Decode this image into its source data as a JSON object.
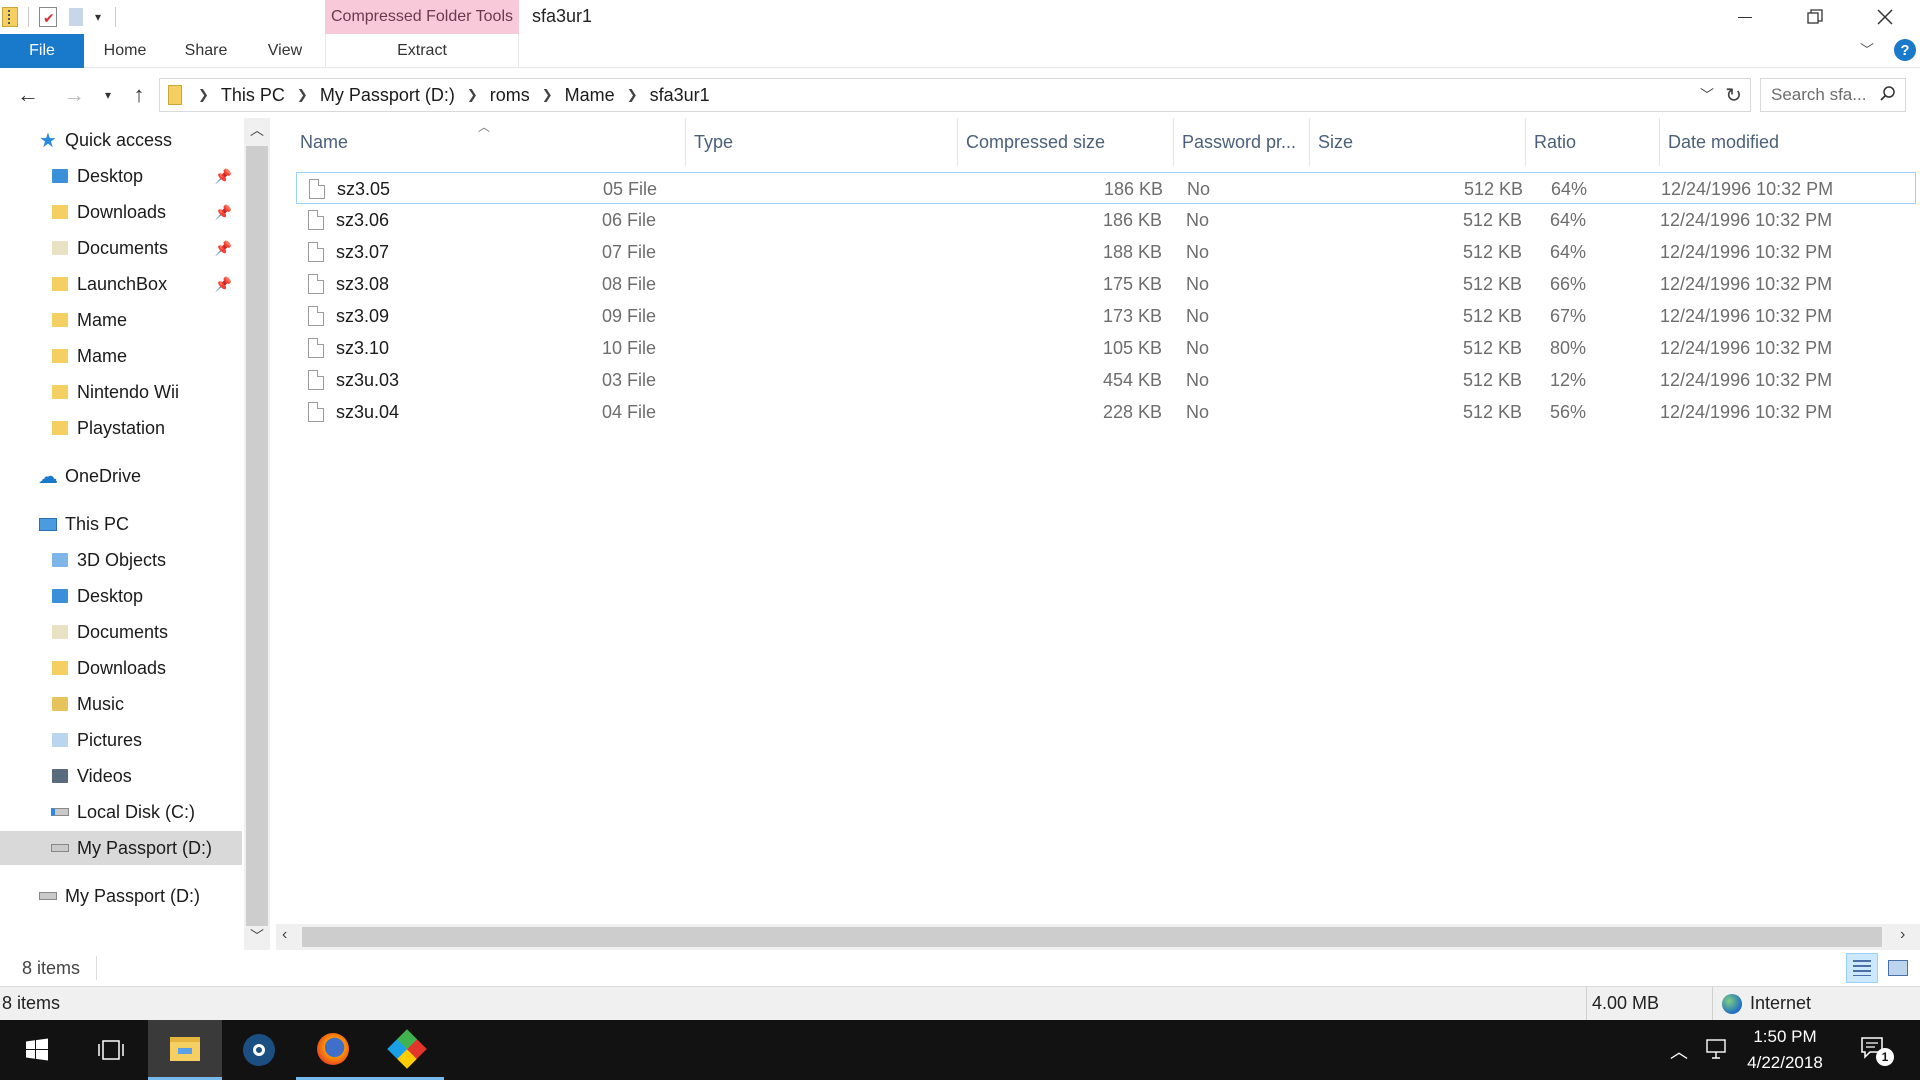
{
  "window": {
    "title": "sfa3ur1",
    "context_tab": "Compressed Folder Tools"
  },
  "ribbon": {
    "tabs": [
      "File",
      "Home",
      "Share",
      "View",
      "Extract"
    ]
  },
  "address": {
    "crumbs": [
      "This PC",
      "My Passport (D:)",
      "roms",
      "Mame",
      "sfa3ur1"
    ],
    "search_placeholder": "Search sfa..."
  },
  "nav": {
    "quick_access": "Quick access",
    "quick_items": [
      {
        "label": "Desktop",
        "pinned": true
      },
      {
        "label": "Downloads",
        "pinned": true
      },
      {
        "label": "Documents",
        "pinned": true
      },
      {
        "label": "LaunchBox",
        "pinned": true
      },
      {
        "label": "Mame",
        "pinned": false
      },
      {
        "label": "Mame",
        "pinned": false
      },
      {
        "label": "Nintendo Wii",
        "pinned": false
      },
      {
        "label": "Playstation",
        "pinned": false
      }
    ],
    "onedrive": "OneDrive",
    "this_pc": "This PC",
    "pc_items": [
      "3D Objects",
      "Desktop",
      "Documents",
      "Downloads",
      "Music",
      "Pictures",
      "Videos",
      "Local Disk (C:)",
      "My Passport (D:)"
    ],
    "drive": "My Passport (D:)"
  },
  "columns": [
    "Name",
    "Type",
    "Compressed size",
    "Password pr...",
    "Size",
    "Ratio",
    "Date modified"
  ],
  "files": [
    {
      "name": "sz3.05",
      "type": "05 File",
      "compressed": "186 KB",
      "password": "No",
      "size": "512 KB",
      "ratio": "64%",
      "date": "12/24/1996 10:32 PM"
    },
    {
      "name": "sz3.06",
      "type": "06 File",
      "compressed": "186 KB",
      "password": "No",
      "size": "512 KB",
      "ratio": "64%",
      "date": "12/24/1996 10:32 PM"
    },
    {
      "name": "sz3.07",
      "type": "07 File",
      "compressed": "188 KB",
      "password": "No",
      "size": "512 KB",
      "ratio": "64%",
      "date": "12/24/1996 10:32 PM"
    },
    {
      "name": "sz3.08",
      "type": "08 File",
      "compressed": "175 KB",
      "password": "No",
      "size": "512 KB",
      "ratio": "66%",
      "date": "12/24/1996 10:32 PM"
    },
    {
      "name": "sz3.09",
      "type": "09 File",
      "compressed": "173 KB",
      "password": "No",
      "size": "512 KB",
      "ratio": "67%",
      "date": "12/24/1996 10:32 PM"
    },
    {
      "name": "sz3.10",
      "type": "10 File",
      "compressed": "105 KB",
      "password": "No",
      "size": "512 KB",
      "ratio": "80%",
      "date": "12/24/1996 10:32 PM"
    },
    {
      "name": "sz3u.03",
      "type": "03 File",
      "compressed": "454 KB",
      "password": "No",
      "size": "512 KB",
      "ratio": "12%",
      "date": "12/24/1996 10:32 PM"
    },
    {
      "name": "sz3u.04",
      "type": "04 File",
      "compressed": "228 KB",
      "password": "No",
      "size": "512 KB",
      "ratio": "56%",
      "date": "12/24/1996 10:32 PM"
    }
  ],
  "status": {
    "items_count": "8 items",
    "items_count_bottom": "8 items",
    "total_size": "4.00 MB",
    "zone": "Internet"
  },
  "taskbar": {
    "time": "1:50 PM",
    "date": "4/22/2018",
    "notifications": "1"
  },
  "colors": {
    "accent": "#1979ca",
    "context_tab": "#f7c9d9",
    "selection_border": "#99d1ff",
    "taskbar": "#121212"
  }
}
